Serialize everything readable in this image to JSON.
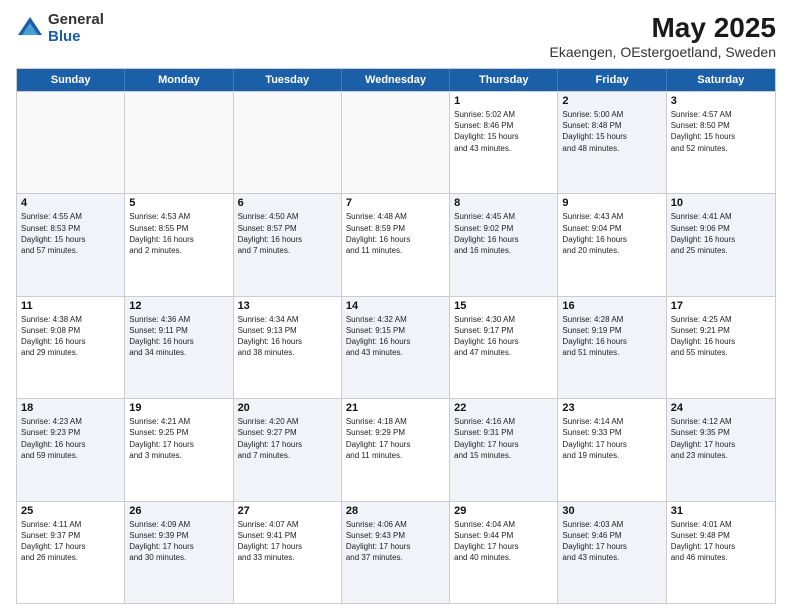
{
  "logo": {
    "general": "General",
    "blue": "Blue"
  },
  "title": "May 2025",
  "subtitle": "Ekaengen, OEstergoetland, Sweden",
  "header_days": [
    "Sunday",
    "Monday",
    "Tuesday",
    "Wednesday",
    "Thursday",
    "Friday",
    "Saturday"
  ],
  "weeks": [
    [
      {
        "day": "",
        "info": "",
        "empty": true
      },
      {
        "day": "",
        "info": "",
        "empty": true
      },
      {
        "day": "",
        "info": "",
        "empty": true
      },
      {
        "day": "",
        "info": "",
        "empty": true
      },
      {
        "day": "1",
        "info": "Sunrise: 5:02 AM\nSunset: 8:46 PM\nDaylight: 15 hours\nand 43 minutes.",
        "shaded": false
      },
      {
        "day": "2",
        "info": "Sunrise: 5:00 AM\nSunset: 8:48 PM\nDaylight: 15 hours\nand 48 minutes.",
        "shaded": true
      },
      {
        "day": "3",
        "info": "Sunrise: 4:57 AM\nSunset: 8:50 PM\nDaylight: 15 hours\nand 52 minutes.",
        "shaded": false
      }
    ],
    [
      {
        "day": "4",
        "info": "Sunrise: 4:55 AM\nSunset: 8:53 PM\nDaylight: 15 hours\nand 57 minutes.",
        "shaded": true
      },
      {
        "day": "5",
        "info": "Sunrise: 4:53 AM\nSunset: 8:55 PM\nDaylight: 16 hours\nand 2 minutes.",
        "shaded": false
      },
      {
        "day": "6",
        "info": "Sunrise: 4:50 AM\nSunset: 8:57 PM\nDaylight: 16 hours\nand 7 minutes.",
        "shaded": true
      },
      {
        "day": "7",
        "info": "Sunrise: 4:48 AM\nSunset: 8:59 PM\nDaylight: 16 hours\nand 11 minutes.",
        "shaded": false
      },
      {
        "day": "8",
        "info": "Sunrise: 4:45 AM\nSunset: 9:02 PM\nDaylight: 16 hours\nand 16 minutes.",
        "shaded": true
      },
      {
        "day": "9",
        "info": "Sunrise: 4:43 AM\nSunset: 9:04 PM\nDaylight: 16 hours\nand 20 minutes.",
        "shaded": false
      },
      {
        "day": "10",
        "info": "Sunrise: 4:41 AM\nSunset: 9:06 PM\nDaylight: 16 hours\nand 25 minutes.",
        "shaded": true
      }
    ],
    [
      {
        "day": "11",
        "info": "Sunrise: 4:38 AM\nSunset: 9:08 PM\nDaylight: 16 hours\nand 29 minutes.",
        "shaded": false
      },
      {
        "day": "12",
        "info": "Sunrise: 4:36 AM\nSunset: 9:11 PM\nDaylight: 16 hours\nand 34 minutes.",
        "shaded": true
      },
      {
        "day": "13",
        "info": "Sunrise: 4:34 AM\nSunset: 9:13 PM\nDaylight: 16 hours\nand 38 minutes.",
        "shaded": false
      },
      {
        "day": "14",
        "info": "Sunrise: 4:32 AM\nSunset: 9:15 PM\nDaylight: 16 hours\nand 43 minutes.",
        "shaded": true
      },
      {
        "day": "15",
        "info": "Sunrise: 4:30 AM\nSunset: 9:17 PM\nDaylight: 16 hours\nand 47 minutes.",
        "shaded": false
      },
      {
        "day": "16",
        "info": "Sunrise: 4:28 AM\nSunset: 9:19 PM\nDaylight: 16 hours\nand 51 minutes.",
        "shaded": true
      },
      {
        "day": "17",
        "info": "Sunrise: 4:25 AM\nSunset: 9:21 PM\nDaylight: 16 hours\nand 55 minutes.",
        "shaded": false
      }
    ],
    [
      {
        "day": "18",
        "info": "Sunrise: 4:23 AM\nSunset: 9:23 PM\nDaylight: 16 hours\nand 59 minutes.",
        "shaded": true
      },
      {
        "day": "19",
        "info": "Sunrise: 4:21 AM\nSunset: 9:25 PM\nDaylight: 17 hours\nand 3 minutes.",
        "shaded": false
      },
      {
        "day": "20",
        "info": "Sunrise: 4:20 AM\nSunset: 9:27 PM\nDaylight: 17 hours\nand 7 minutes.",
        "shaded": true
      },
      {
        "day": "21",
        "info": "Sunrise: 4:18 AM\nSunset: 9:29 PM\nDaylight: 17 hours\nand 11 minutes.",
        "shaded": false
      },
      {
        "day": "22",
        "info": "Sunrise: 4:16 AM\nSunset: 9:31 PM\nDaylight: 17 hours\nand 15 minutes.",
        "shaded": true
      },
      {
        "day": "23",
        "info": "Sunrise: 4:14 AM\nSunset: 9:33 PM\nDaylight: 17 hours\nand 19 minutes.",
        "shaded": false
      },
      {
        "day": "24",
        "info": "Sunrise: 4:12 AM\nSunset: 9:35 PM\nDaylight: 17 hours\nand 23 minutes.",
        "shaded": true
      }
    ],
    [
      {
        "day": "25",
        "info": "Sunrise: 4:11 AM\nSunset: 9:37 PM\nDaylight: 17 hours\nand 26 minutes.",
        "shaded": false
      },
      {
        "day": "26",
        "info": "Sunrise: 4:09 AM\nSunset: 9:39 PM\nDaylight: 17 hours\nand 30 minutes.",
        "shaded": true
      },
      {
        "day": "27",
        "info": "Sunrise: 4:07 AM\nSunset: 9:41 PM\nDaylight: 17 hours\nand 33 minutes.",
        "shaded": false
      },
      {
        "day": "28",
        "info": "Sunrise: 4:06 AM\nSunset: 9:43 PM\nDaylight: 17 hours\nand 37 minutes.",
        "shaded": true
      },
      {
        "day": "29",
        "info": "Sunrise: 4:04 AM\nSunset: 9:44 PM\nDaylight: 17 hours\nand 40 minutes.",
        "shaded": false
      },
      {
        "day": "30",
        "info": "Sunrise: 4:03 AM\nSunset: 9:46 PM\nDaylight: 17 hours\nand 43 minutes.",
        "shaded": true
      },
      {
        "day": "31",
        "info": "Sunrise: 4:01 AM\nSunset: 9:48 PM\nDaylight: 17 hours\nand 46 minutes.",
        "shaded": false
      }
    ]
  ]
}
